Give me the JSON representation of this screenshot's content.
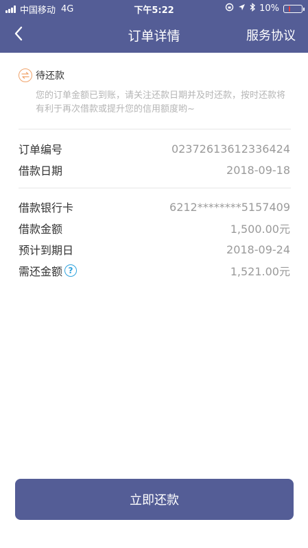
{
  "status_bar": {
    "carrier": "中国移动",
    "network": "4G",
    "time": "下午5:22",
    "battery": "10%",
    "battery_level": 0.1
  },
  "header": {
    "title": "订单详情",
    "right_action": "服务协议",
    "back_icon": "chevron-left-icon"
  },
  "status": {
    "label": "待还款",
    "icon": "exchange-icon",
    "description": "您的订单金额已到账，请关注还款日期并及时还款，按时还款将有利于再次借款或提升您的信用额度哟~"
  },
  "order": {
    "number_label": "订单编号",
    "number_value": "02372613612336424",
    "date_label": "借款日期",
    "date_value": "2018-09-18"
  },
  "loan": {
    "card_label": "借款银行卡",
    "card_value": "6212********5157409",
    "amount_label": "借款金额",
    "amount_value": "1,500.00元",
    "due_label": "预计到期日",
    "due_value": "2018-09-24",
    "repay_label": "需还金额",
    "repay_value": "1,521.00元",
    "help_icon": "question-circle-icon"
  },
  "footer": {
    "repay_button": "立即还款"
  },
  "colors": {
    "primary": "#545d96",
    "status_orange": "#f0a36b",
    "help_blue": "#2ea2dd"
  }
}
